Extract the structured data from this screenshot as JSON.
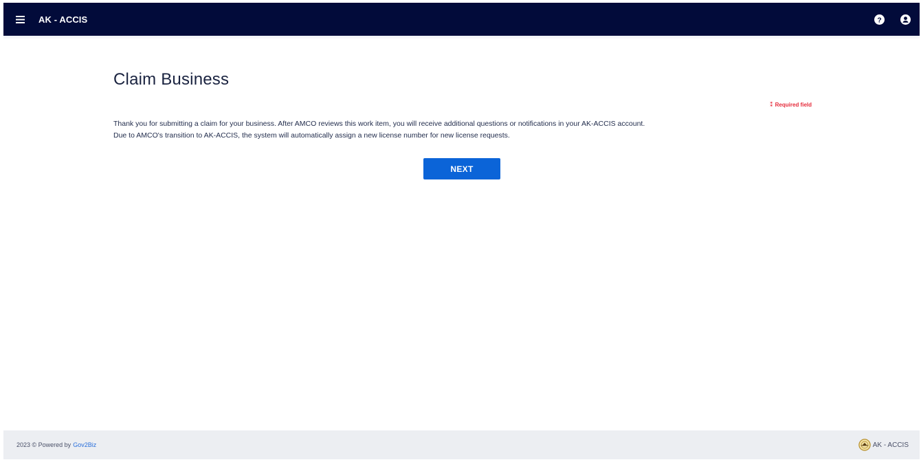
{
  "header": {
    "app_title": "AK - ACCIS",
    "menu_icon": "hamburger-menu-icon",
    "help_icon": "question-circle-icon",
    "user_icon": "user-circle-icon",
    "bg_color": "#020b3a"
  },
  "main": {
    "title": "Claim Business",
    "required_icon": "required-marker-icon",
    "required_label": "Required field",
    "paragraphs": [
      "Thank you for submitting a claim for your business. After AMCO reviews this work item, you will receive additional questions or notifications in your AK-ACCIS account.",
      "Due to AMCO's transition to AK-ACCIS, the system will automatically assign a new license number for new license requests."
    ],
    "next_label": "NEXT",
    "accent_color": "#0b64d8",
    "required_color": "#e52a3a"
  },
  "footer": {
    "copyright": "2023 © Powered by",
    "link_label": "Gov2Biz",
    "logo_icon": "ak-accis-seal-logo",
    "brand_label": "AK - ACCIS"
  }
}
